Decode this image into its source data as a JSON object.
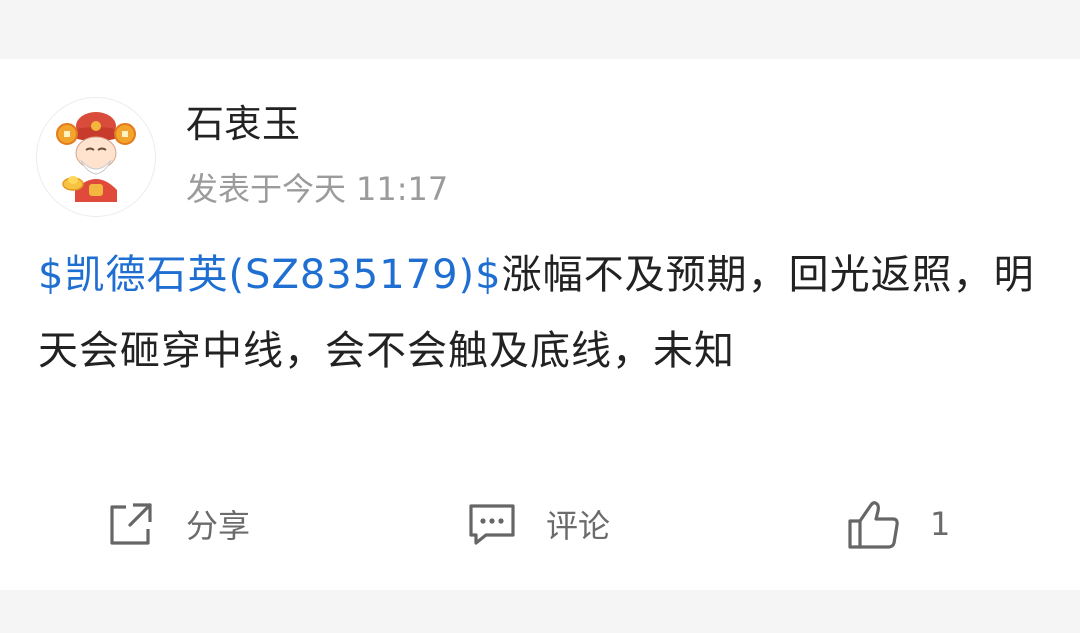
{
  "post": {
    "author": "石衷玉",
    "meta": {
      "prefix": "发表于今天",
      "time": "11:17"
    },
    "stock_tag": "$凯德石英(SZ835179)$",
    "content": "涨幅不及预期，回光返照，明天会砸穿中线，会不会触及底线，未知"
  },
  "actions": {
    "share": "分享",
    "comment": "评论",
    "like_count": "1"
  },
  "icons": {
    "avatar": "fortune-god-avatar-icon",
    "share": "share-external-icon",
    "comment": "comment-bubble-icon",
    "like": "thumbs-up-icon"
  },
  "colors": {
    "link": "#1f6fd2",
    "text": "#222222",
    "muted": "#9b9b9b",
    "background": "#f5f5f5"
  }
}
